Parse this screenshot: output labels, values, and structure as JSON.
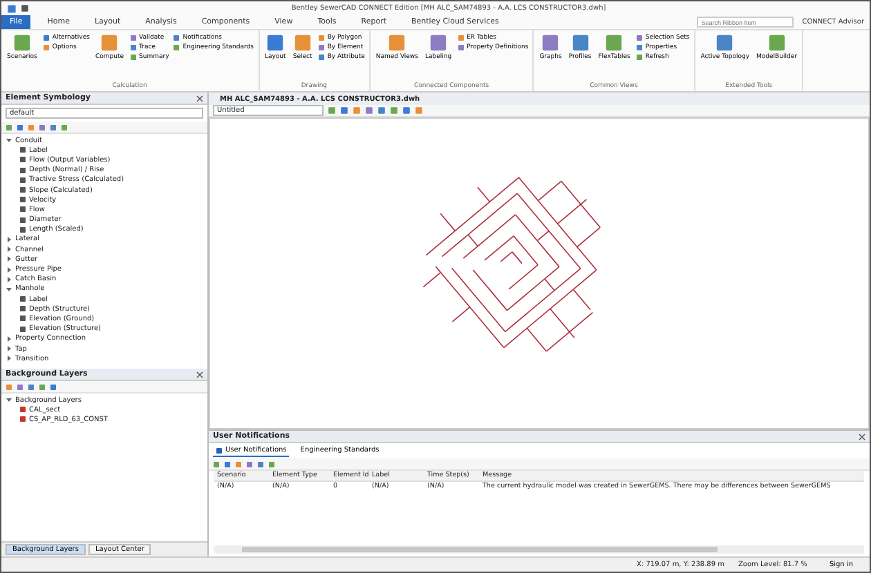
{
  "window": {
    "title": "Bentley SewerCAD CONNECT Edition [MH ALC_SAM74893 - A.A. LCS CONSTRUCTOR3.dwh]"
  },
  "ribbon_tabs": [
    {
      "label": "File",
      "selected": true
    },
    {
      "label": "Home",
      "selected": false
    },
    {
      "label": "Layout",
      "selected": false
    },
    {
      "label": "Analysis",
      "selected": false
    },
    {
      "label": "Components",
      "selected": false
    },
    {
      "label": "View",
      "selected": false
    },
    {
      "label": "Tools",
      "selected": false
    },
    {
      "label": "Report",
      "selected": false
    },
    {
      "label": "Bentley Cloud Services",
      "selected": false
    }
  ],
  "search": {
    "placeholder": "Search Ribbon Item"
  },
  "account": "CONNECT Advisor",
  "ribbon_groups": [
    {
      "label": "Calculation",
      "columns": [
        {
          "kind": "large",
          "label": "Scenarios"
        },
        {
          "kind": "stack",
          "items": [
            "Alternatives",
            "Options"
          ]
        },
        {
          "kind": "large",
          "label": "Compute"
        },
        {
          "kind": "stack",
          "items": [
            "Validate",
            "Trace",
            "Summary"
          ]
        },
        {
          "kind": "stack",
          "items": [
            "Notifications",
            "Engineering Standards"
          ]
        }
      ]
    },
    {
      "label": "Drawing",
      "columns": [
        {
          "kind": "large",
          "label": "Layout"
        },
        {
          "kind": "large",
          "label": "Select"
        },
        {
          "kind": "stack",
          "items": [
            "By Polygon",
            "By Element",
            "By Attribute"
          ]
        }
      ]
    },
    {
      "label": "Connected Components",
      "columns": [
        {
          "kind": "large",
          "label": "Named Views"
        },
        {
          "kind": "large",
          "label": "Labeling"
        },
        {
          "kind": "stack",
          "items": [
            "ER Tables",
            "Property Definitions"
          ]
        }
      ]
    },
    {
      "label": "Common Views",
      "columns": [
        {
          "kind": "large",
          "label": "Graphs"
        },
        {
          "kind": "large",
          "label": "Profiles"
        },
        {
          "kind": "large",
          "label": "FlexTables"
        },
        {
          "kind": "stack",
          "items": [
            "Selection Sets",
            "Properties",
            "Refresh"
          ]
        }
      ]
    },
    {
      "label": "Extended Tools",
      "columns": [
        {
          "kind": "large",
          "label": "Active Topology"
        },
        {
          "kind": "large",
          "label": "ModelBuilder"
        }
      ]
    }
  ],
  "symbology": {
    "title": "Element Symbology",
    "dropdown": "default",
    "tree": [
      {
        "label": "Conduit",
        "expanded": true,
        "children": [
          {
            "label": "Label"
          },
          {
            "label": "Flow (Output Variables)"
          },
          {
            "label": "Depth (Normal) / Rise"
          },
          {
            "label": "Tractive Stress (Calculated)"
          },
          {
            "label": "Slope (Calculated)"
          },
          {
            "label": "Velocity"
          },
          {
            "label": "Flow"
          },
          {
            "label": "Diameter"
          },
          {
            "label": "Length (Scaled)"
          }
        ]
      },
      {
        "label": "Lateral",
        "expanded": false
      },
      {
        "label": "Channel",
        "expanded": false
      },
      {
        "label": "Gutter",
        "expanded": false
      },
      {
        "label": "Pressure Pipe",
        "expanded": false
      },
      {
        "label": "Catch Basin",
        "expanded": false
      },
      {
        "label": "Manhole",
        "expanded": true,
        "children": [
          {
            "label": "Label"
          },
          {
            "label": "Depth (Structure)"
          },
          {
            "label": "Elevation (Ground)"
          },
          {
            "label": "Elevation (Structure)"
          }
        ]
      },
      {
        "label": "Property Connection",
        "expanded": false
      },
      {
        "label": "Tap",
        "expanded": false
      },
      {
        "label": "Transition",
        "expanded": false
      }
    ]
  },
  "background_layers": {
    "title": "Background Layers",
    "tree": [
      {
        "label": "Background Layers",
        "expanded": true,
        "children": [
          {
            "label": "CAL_sect"
          },
          {
            "label": "CS_AP_RLD_63_CONST"
          }
        ]
      }
    ]
  },
  "panel_tabs": [
    {
      "label": "Background Layers",
      "selected": true
    },
    {
      "label": "Layout Center",
      "selected": false
    }
  ],
  "drawing": {
    "title": "MH ALC_SAM74893 - A.A. LCS CONSTRUCTOR3.dwh",
    "view_dropdown": "Untitled"
  },
  "notifications": {
    "title": "User Notifications",
    "tabs": [
      {
        "label": "User Notifications",
        "selected": true
      },
      {
        "label": "Engineering Standards",
        "selected": false
      }
    ],
    "columns": [
      "Scenario",
      "Element Type",
      "Element Id",
      "Label",
      "Time Step(s)",
      "Message"
    ],
    "rows": [
      [
        "(N/A)",
        "(N/A)",
        "0",
        "(N/A)",
        "(N/A)",
        "The current hydraulic model was created in SewerGEMS. There may be differences between SewerGEMS"
      ]
    ]
  },
  "status_bar": {
    "coordinates": "X: 719.07 m, Y: 238.89 m",
    "zoom": "Zoom Level: 81.7 %",
    "sign_in": "Sign in"
  }
}
